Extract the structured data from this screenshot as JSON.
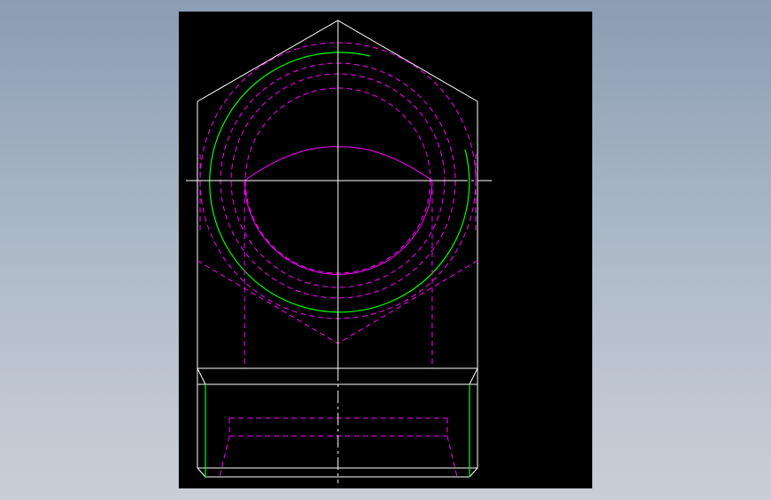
{
  "viewport": {
    "background": "#000000"
  },
  "drawing": {
    "views": [
      "top-view",
      "front-view"
    ],
    "colors": {
      "outline": "#ffffff",
      "hidden_line": "#ff00ff",
      "thread_line": "#00ff00",
      "center_line": "#ffffff"
    }
  }
}
